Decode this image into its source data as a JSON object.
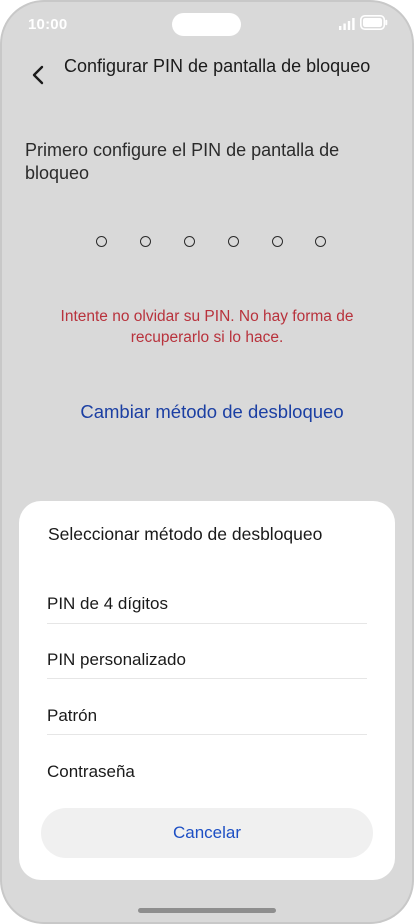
{
  "status_bar": {
    "time": "10:00",
    "signal_icon": "cellular-signal-icon",
    "battery_icon": "battery-icon"
  },
  "header": {
    "back_icon": "chevron-left-icon",
    "title": "Configurar PIN de pantalla de bloqueo"
  },
  "main": {
    "instruction": "Primero configure el PIN de pantalla de bloqueo",
    "pin_length": 6,
    "warning": "Intente no olvidar su PIN. No hay forma de recuperarlo si lo hace.",
    "change_method": "Cambiar método de desbloqueo"
  },
  "sheet": {
    "title": "Seleccionar método de desbloqueo",
    "options": [
      {
        "label": "PIN de 4 dígitos"
      },
      {
        "label": "PIN personalizado"
      },
      {
        "label": "Patrón"
      },
      {
        "label": "Contraseña"
      }
    ],
    "cancel": "Cancelar"
  },
  "colors": {
    "warning": "#b8323c",
    "link": "#1b3fa3",
    "cancel": "#1d4fc4",
    "scrim": "#d9d9d9"
  }
}
